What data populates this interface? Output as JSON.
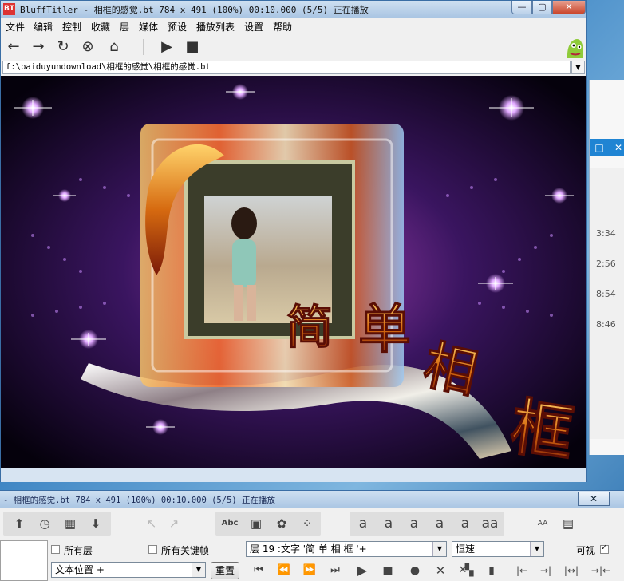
{
  "window": {
    "app_icon": "BT",
    "title": "BluffTitler - 相框的感觉.bt 784 x 491 (100%) 00:10.000 (5/5) 正在播放",
    "min_label": "—",
    "max_label": "▢",
    "close_label": "✕"
  },
  "menu": [
    "文件",
    "编辑",
    "控制",
    "收藏",
    "层",
    "媒体",
    "预设",
    "播放列表",
    "设置",
    "帮助"
  ],
  "toolbar_icons": [
    "back-arrow-icon",
    "forward-arrow-icon",
    "refresh-icon",
    "stop-circle-icon",
    "home-icon",
    "play-icon",
    "stop-icon"
  ],
  "toolbar_glyphs": [
    "←",
    "→",
    "↻",
    "⊗",
    "⌂",
    "▶",
    "■"
  ],
  "path": "f:\\baiduyundownload\\相框的感觉\\相框的感觉.bt",
  "scene": {
    "chars": [
      "简",
      "单",
      "相",
      "框"
    ]
  },
  "bg_window": {
    "max_glyph": "□",
    "close_glyph": "✕",
    "times": [
      "3:34",
      "2:56",
      "8:54",
      "8:46"
    ]
  },
  "panel": {
    "title": "- 相框的感觉.bt 784 x 491 (100%) 00:10.000 (5/5) 正在播放",
    "close_label": "✕",
    "tools_row1": [
      {
        "name": "layer-up-icon",
        "glyph": "⬆"
      },
      {
        "name": "clock-icon",
        "glyph": "◷"
      },
      {
        "name": "layers-icon",
        "glyph": "▦"
      },
      {
        "name": "layer-down-icon",
        "glyph": "⬇"
      },
      {
        "name": "arrow-up-left-icon",
        "glyph": "↖"
      },
      {
        "name": "arrow-up-right-icon",
        "glyph": "↗"
      },
      {
        "name": "text-abc-icon",
        "glyph": "Abc"
      },
      {
        "name": "picture-layer-icon",
        "glyph": "▣"
      },
      {
        "name": "shape-layer-icon",
        "glyph": "✿"
      },
      {
        "name": "particles-icon",
        "glyph": "⁘"
      },
      {
        "name": "text-style-1-icon",
        "glyph": "a"
      },
      {
        "name": "text-style-2-icon",
        "glyph": "a"
      },
      {
        "name": "text-style-3-icon",
        "glyph": "a"
      },
      {
        "name": "text-style-4-icon",
        "glyph": "a"
      },
      {
        "name": "text-style-5-icon",
        "glyph": "a"
      },
      {
        "name": "text-style-6-icon",
        "glyph": "aa"
      },
      {
        "name": "font-size-icon",
        "glyph": "AA"
      },
      {
        "name": "document-icon",
        "glyph": "▤"
      }
    ],
    "all_layers_label": "所有层",
    "all_keyframes_label": "所有关键帧",
    "layer_combo": "层   19  :文字 '简 单 相 框     '+",
    "speed_combo": "恒速",
    "visible_label": "可视",
    "text_position_combo": "文本位置 +",
    "reset_label": "重置",
    "transport_icons": [
      {
        "name": "first-frame-icon",
        "glyph": "⏮"
      },
      {
        "name": "prev-frame-icon",
        "glyph": "⏪"
      },
      {
        "name": "next-frame-icon",
        "glyph": "⏩"
      },
      {
        "name": "last-frame-icon",
        "glyph": "⏭"
      },
      {
        "name": "play-icon",
        "glyph": "▶"
      },
      {
        "name": "stop-icon",
        "glyph": "■"
      },
      {
        "name": "record-icon",
        "glyph": "●"
      },
      {
        "name": "delete-key-icon",
        "glyph": "✕"
      },
      {
        "name": "delete-all-icon",
        "glyph": "✕"
      },
      {
        "name": "copy-key-icon",
        "glyph": "▚"
      },
      {
        "name": "save-key-icon",
        "glyph": "▮"
      },
      {
        "name": "align-left-icon",
        "glyph": "|←"
      },
      {
        "name": "align-right-icon",
        "glyph": "→|"
      },
      {
        "name": "expand-icon",
        "glyph": "|↔|"
      },
      {
        "name": "collapse-icon",
        "glyph": "→|←"
      }
    ]
  }
}
